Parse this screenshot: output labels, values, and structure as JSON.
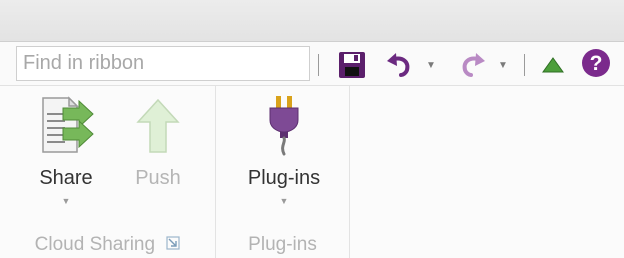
{
  "toolbar": {
    "search_placeholder": "Find in ribbon"
  },
  "ribbon": {
    "groups": [
      {
        "label": "Cloud Sharing",
        "buttons": [
          {
            "label": "Share",
            "icon": "share-icon",
            "enabled": true,
            "has_dropdown": true
          },
          {
            "label": "Push",
            "icon": "push-arrow-icon",
            "enabled": false,
            "has_dropdown": false
          }
        ]
      },
      {
        "label": "Plug-ins",
        "buttons": [
          {
            "label": "Plug-ins",
            "icon": "plug-icon",
            "enabled": true,
            "has_dropdown": true
          }
        ]
      }
    ]
  },
  "colors": {
    "accent_purple": "#7b2a8c",
    "collapse_green": "#4c9e3a"
  }
}
